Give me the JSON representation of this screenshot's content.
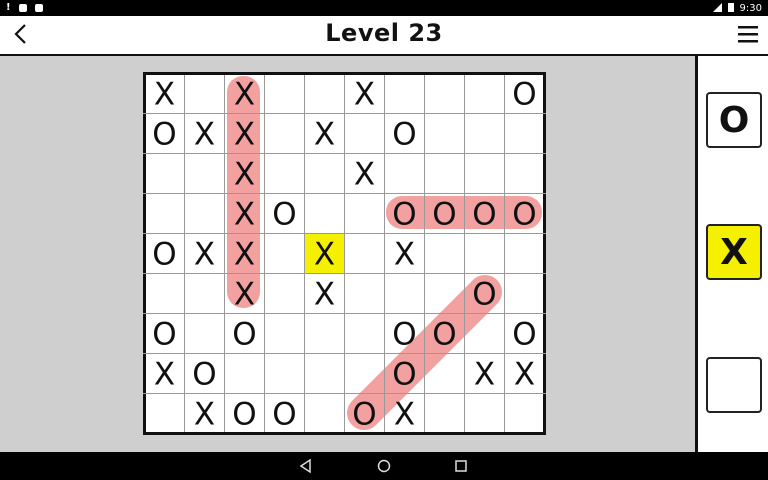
{
  "status_bar": {
    "time": "9:30"
  },
  "header": {
    "title": "Level 23",
    "back_icon": "chevron-left-icon",
    "menu_icon": "hamburger-menu-icon"
  },
  "board": {
    "rows": 9,
    "cols": 10,
    "grid": [
      [
        "X",
        "",
        "X",
        "",
        "",
        "X",
        "",
        "",
        "",
        "O"
      ],
      [
        "O",
        "X",
        "X",
        "",
        "X",
        "",
        "O",
        "",
        "",
        ""
      ],
      [
        "",
        "",
        "X",
        "",
        "",
        "X",
        "",
        "",
        "",
        ""
      ],
      [
        "",
        "",
        "X",
        "O",
        "",
        "",
        "O",
        "O",
        "O",
        "O"
      ],
      [
        "O",
        "X",
        "X",
        "",
        "X",
        "",
        "X",
        "",
        "",
        ""
      ],
      [
        "",
        "",
        "X",
        "",
        "X",
        "",
        "",
        "",
        "O",
        ""
      ],
      [
        "O",
        "",
        "O",
        "",
        "",
        "",
        "O",
        "O",
        "",
        "O"
      ],
      [
        "X",
        "O",
        "",
        "",
        "",
        "",
        "O",
        "",
        "X",
        "X"
      ],
      [
        "",
        "X",
        "O",
        "O",
        "",
        "O",
        "X",
        "",
        "",
        ""
      ]
    ],
    "selected_cell": {
      "row": 4,
      "col": 4
    },
    "highlight_color": "#f2a0a0",
    "selected_color": "#f5f000"
  },
  "palette": {
    "o_label": "O",
    "x_label": "X",
    "blank_label": "",
    "active_color": "#f5f000"
  },
  "navbar": {
    "back_icon": "nav-back-icon",
    "home_icon": "nav-home-icon",
    "recents_icon": "nav-recents-icon"
  }
}
